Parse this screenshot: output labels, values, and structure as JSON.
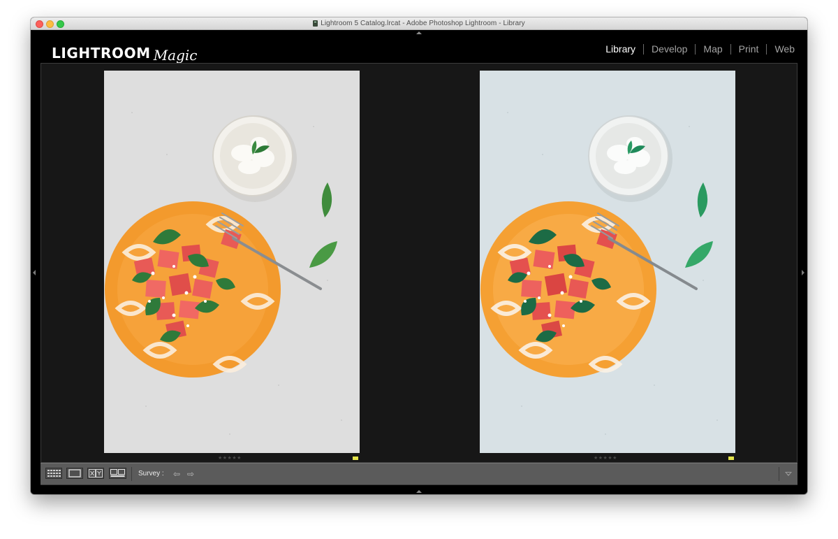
{
  "window": {
    "title": "Lightroom 5 Catalog.lrcat - Adobe Photoshop Lightroom - Library"
  },
  "brand": {
    "name": "LIGHTROOM",
    "script": "Magic"
  },
  "modules": [
    {
      "label": "Library",
      "active": true
    },
    {
      "label": "Develop",
      "active": false
    },
    {
      "label": "Map",
      "active": false
    },
    {
      "label": "Print",
      "active": false
    },
    {
      "label": "Web",
      "active": false
    }
  ],
  "photos": [
    {
      "stars": "★★★★★",
      "flag_color": "#e3e34a",
      "tone": "warm"
    },
    {
      "stars": "★★★★★",
      "flag_color": "#e3e34a",
      "tone": "cool"
    }
  ],
  "toolbar": {
    "views": [
      "grid-view-icon",
      "loupe-view-icon",
      "compare-view-icon",
      "survey-view-icon"
    ],
    "mode_label": "Survey :",
    "prev_arrow": "⇦",
    "next_arrow": "⇨"
  },
  "colors": {
    "plate_orange": "#f39a2d",
    "watermelon": "#e85a56",
    "mint": "#2f7a3a",
    "flag_yellow": "#e3e34a"
  }
}
